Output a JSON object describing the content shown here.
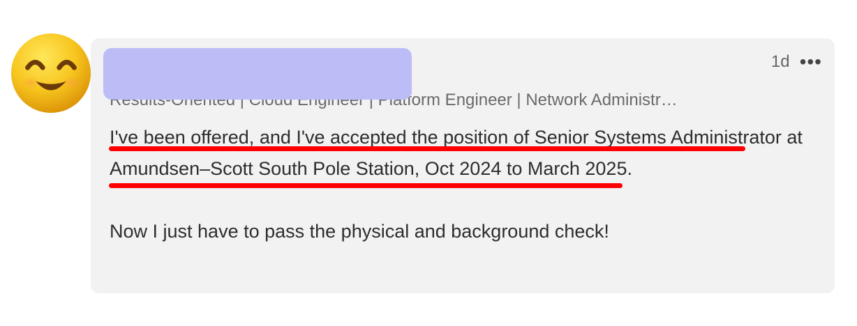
{
  "post": {
    "timestamp": "1d",
    "more_label": "•••",
    "headline": "Results-Oriented | Cloud Engineer | Platform Engineer | Network Administr…",
    "body": {
      "paragraph1": "I've been offered, and I've accepted the position of Senior Systems Administrator at Amundsen–Scott South Pole Station, Oct 2024 to March 2025.",
      "paragraph2": "Now I just have to pass the physical and background check!"
    },
    "avatar_icon": "smiling-face-icon"
  },
  "colors": {
    "bubble": "#f2f2f2",
    "redaction": "#bcbcf7",
    "annotation": "#ff0000",
    "text": "#2d2d2d",
    "muted": "#6a6a6a"
  }
}
